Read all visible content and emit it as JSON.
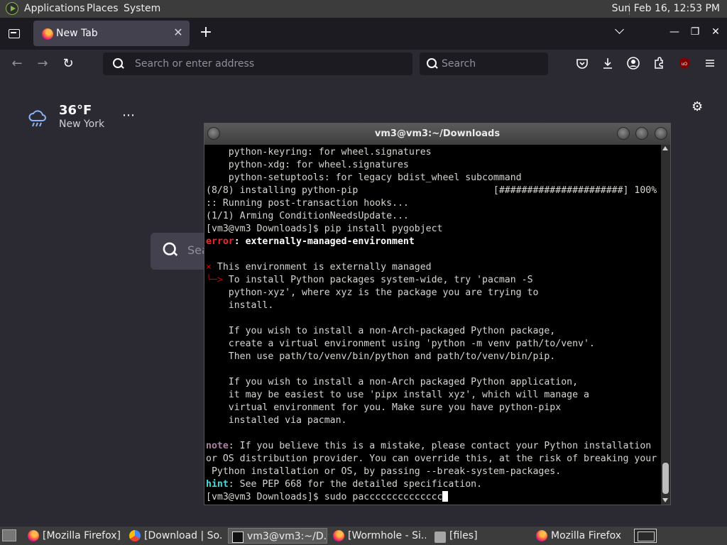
{
  "top_panel": {
    "menus": [
      "Applications",
      "Places",
      "System"
    ],
    "clock": "Sun Feb 16, 12:53 PM"
  },
  "browser": {
    "tab": {
      "label": "New Tab"
    },
    "urlbar": {
      "placeholder": "Search or enter address"
    },
    "searchbar": {
      "placeholder": "Search"
    },
    "toolbar_icons": [
      "pocket-icon",
      "downloads-icon",
      "account-icon",
      "extensions-icon",
      "ublock-icon",
      "menu-icon"
    ],
    "newtab": {
      "weather": {
        "temp": "36°F",
        "city": "New York",
        "more": "⋯"
      },
      "search_placeholder": "Sea"
    }
  },
  "terminal": {
    "title": "vm3@vm3:~/Downloads",
    "lines": [
      [
        {
          "t": "    python-keyring: for wheel.signatures"
        }
      ],
      [
        {
          "t": "    python-xdg: for wheel.signatures"
        }
      ],
      [
        {
          "t": "    python-setuptools: for legacy bdist_wheel subcommand"
        }
      ],
      [
        {
          "t": "(8/8) installing python-pip                        [######################] 100%"
        }
      ],
      [
        {
          "t": ":: Running post-transaction hooks..."
        }
      ],
      [
        {
          "t": "(1/1) Arming ConditionNeedsUpdate..."
        }
      ],
      [
        {
          "t": "[vm3@vm3 Downloads]$ pip install pygobject"
        }
      ],
      [
        {
          "t": "error",
          "c": "err"
        },
        {
          "t": ": externally-managed-environment",
          "c": "bold"
        }
      ],
      [
        {
          "t": ""
        }
      ],
      [
        {
          "t": "×",
          "c": "red"
        },
        {
          "t": " This environment is externally managed"
        }
      ],
      [
        {
          "t": "╰─>",
          "c": "red"
        },
        {
          "t": " To install Python packages system-wide, try 'pacman -S"
        }
      ],
      [
        {
          "t": "    python-xyz', where xyz is the package you are trying to"
        }
      ],
      [
        {
          "t": "    install."
        }
      ],
      [
        {
          "t": ""
        }
      ],
      [
        {
          "t": "    If you wish to install a non-Arch-packaged Python package,"
        }
      ],
      [
        {
          "t": "    create a virtual environment using 'python -m venv path/to/venv'."
        }
      ],
      [
        {
          "t": "    Then use path/to/venv/bin/python and path/to/venv/bin/pip."
        }
      ],
      [
        {
          "t": ""
        }
      ],
      [
        {
          "t": "    If you wish to install a non-Arch packaged Python application,"
        }
      ],
      [
        {
          "t": "    it may be easiest to use 'pipx install xyz', which will manage a"
        }
      ],
      [
        {
          "t": "    virtual environment for you. Make sure you have python-pipx"
        }
      ],
      [
        {
          "t": "    installed via pacman."
        }
      ],
      [
        {
          "t": ""
        }
      ],
      [
        {
          "t": "note",
          "c": "note"
        },
        {
          "t": ": If you believe this is a mistake, please contact your Python installation"
        }
      ],
      [
        {
          "t": "or OS distribution provider. You can override this, at the risk of breaking your"
        }
      ],
      [
        {
          "t": " Python installation or OS, by passing --break-system-packages."
        }
      ],
      [
        {
          "t": "hint",
          "c": "hint"
        },
        {
          "t": ": See PEP 668 for the detailed specification."
        }
      ],
      [
        {
          "t": "[vm3@vm3 Downloads]$ sudo pacccccccccccccc"
        },
        {
          "t": "",
          "c": "cursor"
        }
      ]
    ]
  },
  "taskbar": {
    "tasks": [
      {
        "label": "[Mozilla Firefox]",
        "icon": "firefox-icon"
      },
      {
        "label": "[Download | So...",
        "icon": "chrome-icon"
      },
      {
        "label": "vm3@vm3:~/D...",
        "icon": "terminal-icon",
        "active": true
      },
      {
        "label": "[Wormhole - Si...",
        "icon": "firefox-icon"
      },
      {
        "label": "[files]",
        "icon": "folder-icon"
      },
      {
        "label": "Mozilla Firefox",
        "icon": "firefox-icon"
      }
    ]
  },
  "colors": {
    "firefox_bg": "#2b2a33",
    "terminal_bg": "#000000",
    "error_red": "#ef2929",
    "hint_cyan": "#34e2e2",
    "note_purple": "#ad7fa8"
  }
}
